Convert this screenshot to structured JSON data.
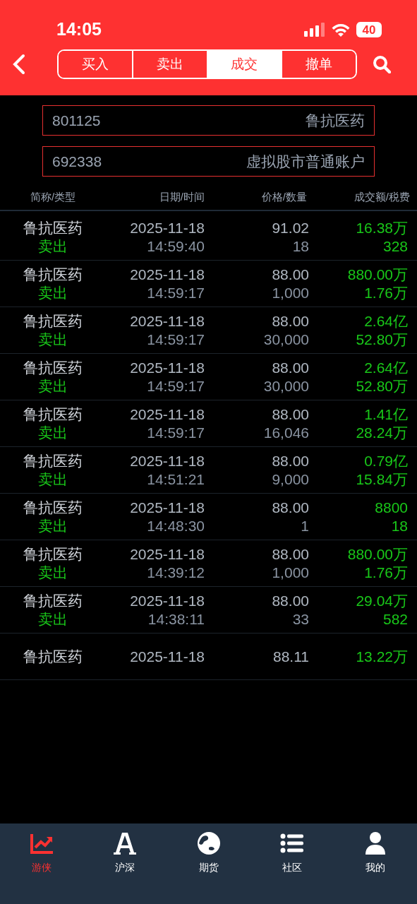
{
  "status_bar": {
    "time": "14:05",
    "battery": "40"
  },
  "tabs": [
    {
      "label": "买入",
      "selected": false
    },
    {
      "label": "卖出",
      "selected": false
    },
    {
      "label": "成交",
      "selected": true
    },
    {
      "label": "撤单",
      "selected": false
    }
  ],
  "stock_field": {
    "code": "801125",
    "name": "鲁抗医药"
  },
  "account_field": {
    "code": "692338",
    "name": "虚拟股市普通账户"
  },
  "table": {
    "columns": [
      "简称/类型",
      "日期/时间",
      "价格/数量",
      "成交额/税费"
    ],
    "rows": [
      {
        "name": "鲁抗医药",
        "type": "卖出",
        "date": "2025-11-18",
        "time": "14:59:40",
        "price": "91.02",
        "quantity": "18",
        "amount": "16.38万",
        "fee": "328"
      },
      {
        "name": "鲁抗医药",
        "type": "卖出",
        "date": "2025-11-18",
        "time": "14:59:17",
        "price": "88.00",
        "quantity": "1,000",
        "amount": "880.00万",
        "fee": "1.76万"
      },
      {
        "name": "鲁抗医药",
        "type": "卖出",
        "date": "2025-11-18",
        "time": "14:59:17",
        "price": "88.00",
        "quantity": "30,000",
        "amount": "2.64亿",
        "fee": "52.80万"
      },
      {
        "name": "鲁抗医药",
        "type": "卖出",
        "date": "2025-11-18",
        "time": "14:59:17",
        "price": "88.00",
        "quantity": "30,000",
        "amount": "2.64亿",
        "fee": "52.80万"
      },
      {
        "name": "鲁抗医药",
        "type": "卖出",
        "date": "2025-11-18",
        "time": "14:59:17",
        "price": "88.00",
        "quantity": "16,046",
        "amount": "1.41亿",
        "fee": "28.24万"
      },
      {
        "name": "鲁抗医药",
        "type": "卖出",
        "date": "2025-11-18",
        "time": "14:51:21",
        "price": "88.00",
        "quantity": "9,000",
        "amount": "0.79亿",
        "fee": "15.84万"
      },
      {
        "name": "鲁抗医药",
        "type": "卖出",
        "date": "2025-11-18",
        "time": "14:48:30",
        "price": "88.00",
        "quantity": "1",
        "amount": "8800",
        "fee": "18"
      },
      {
        "name": "鲁抗医药",
        "type": "卖出",
        "date": "2025-11-18",
        "time": "14:39:12",
        "price": "88.00",
        "quantity": "1,000",
        "amount": "880.00万",
        "fee": "1.76万"
      },
      {
        "name": "鲁抗医药",
        "type": "卖出",
        "date": "2025-11-18",
        "time": "14:38:11",
        "price": "88.00",
        "quantity": "33",
        "amount": "29.04万",
        "fee": "582"
      },
      {
        "name": "鲁抗医药",
        "date": "2025-11-18",
        "price": "88.11",
        "amount": "13.22万"
      }
    ]
  },
  "bottom_nav": [
    {
      "label": "游侠",
      "kind": "chart",
      "selected": true
    },
    {
      "label": "沪深",
      "kind": "letter",
      "selected": false
    },
    {
      "label": "期货",
      "kind": "globe",
      "selected": false
    },
    {
      "label": "社区",
      "kind": "list",
      "selected": false
    },
    {
      "label": "我的",
      "kind": "person",
      "selected": false
    }
  ]
}
